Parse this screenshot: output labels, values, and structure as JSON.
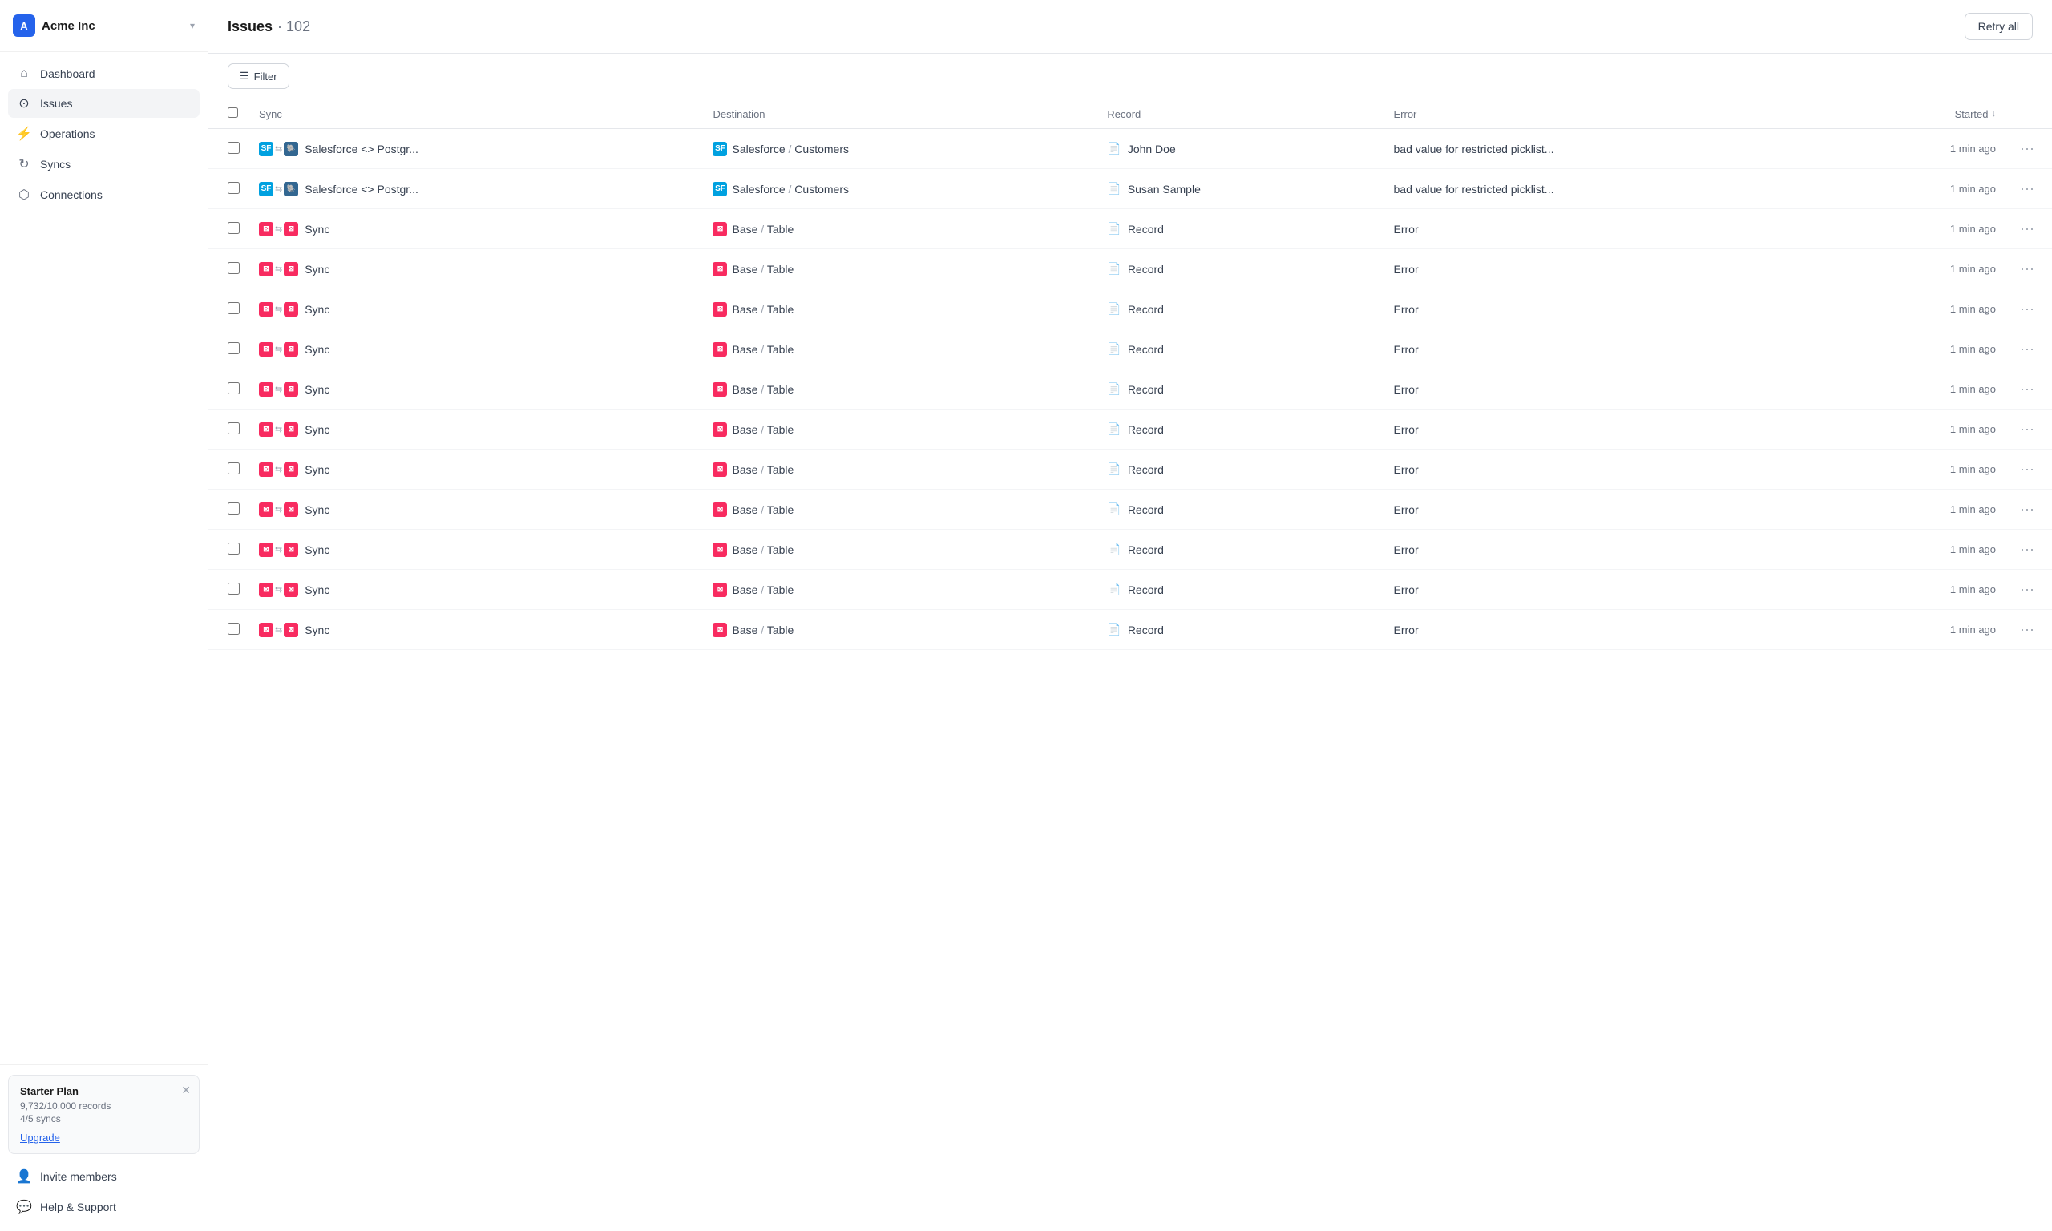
{
  "sidebar": {
    "company": "Acme Inc",
    "avatar_letter": "A",
    "nav_items": [
      {
        "id": "dashboard",
        "label": "Dashboard",
        "icon": "⌂",
        "active": false
      },
      {
        "id": "issues",
        "label": "Issues",
        "icon": "⊙",
        "active": true
      },
      {
        "id": "operations",
        "label": "Operations",
        "icon": "⚡",
        "active": false
      },
      {
        "id": "syncs",
        "label": "Syncs",
        "icon": "↻",
        "active": false
      },
      {
        "id": "connections",
        "label": "Connections",
        "icon": "⬡",
        "active": false
      }
    ],
    "plan": {
      "title": "Starter Plan",
      "records": "9,732/10,000 records",
      "syncs": "4/5 syncs",
      "upgrade_label": "Upgrade"
    },
    "bottom_items": [
      {
        "id": "invite",
        "label": "Invite members",
        "icon": "👤"
      },
      {
        "id": "help",
        "label": "Help & Support",
        "icon": "💬"
      }
    ]
  },
  "header": {
    "title": "Issues",
    "count": "102",
    "retry_button": "Retry all"
  },
  "toolbar": {
    "filter_button": "Filter"
  },
  "table": {
    "columns": [
      "Sync",
      "Destination",
      "Record",
      "Error",
      "Started"
    ],
    "rows": [
      {
        "sync_label": "Salesforce <> Postgr...",
        "sync_type": "sf-pg",
        "destination_icon": "sf",
        "destination": "Salesforce / Customers",
        "record": "John Doe",
        "error": "bad value for restricted picklist...",
        "started": "1 min ago"
      },
      {
        "sync_label": "Salesforce <> Postgr...",
        "sync_type": "sf-pg",
        "destination_icon": "sf",
        "destination": "Salesforce / Customers",
        "record": "Susan Sample",
        "error": "bad value for restricted picklist...",
        "started": "1 min ago"
      },
      {
        "sync_label": "Sync",
        "sync_type": "at-at",
        "destination_icon": "at",
        "destination": "Base / Table",
        "record": "Record",
        "error": "Error",
        "started": "1 min ago"
      },
      {
        "sync_label": "Sync",
        "sync_type": "at-at",
        "destination_icon": "at",
        "destination": "Base / Table",
        "record": "Record",
        "error": "Error",
        "started": "1 min ago"
      },
      {
        "sync_label": "Sync",
        "sync_type": "at-at",
        "destination_icon": "at",
        "destination": "Base / Table",
        "record": "Record",
        "error": "Error",
        "started": "1 min ago"
      },
      {
        "sync_label": "Sync",
        "sync_type": "at-at",
        "destination_icon": "at",
        "destination": "Base / Table",
        "record": "Record",
        "error": "Error",
        "started": "1 min ago"
      },
      {
        "sync_label": "Sync",
        "sync_type": "at-at",
        "destination_icon": "at",
        "destination": "Base / Table",
        "record": "Record",
        "error": "Error",
        "started": "1 min ago"
      },
      {
        "sync_label": "Sync",
        "sync_type": "at-at",
        "destination_icon": "at",
        "destination": "Base / Table",
        "record": "Record",
        "error": "Error",
        "started": "1 min ago"
      },
      {
        "sync_label": "Sync",
        "sync_type": "at-at",
        "destination_icon": "at",
        "destination": "Base / Table",
        "record": "Record",
        "error": "Error",
        "started": "1 min ago"
      },
      {
        "sync_label": "Sync",
        "sync_type": "at-at",
        "destination_icon": "at",
        "destination": "Base / Table",
        "record": "Record",
        "error": "Error",
        "started": "1 min ago"
      },
      {
        "sync_label": "Sync",
        "sync_type": "at-at",
        "destination_icon": "at",
        "destination": "Base / Table",
        "record": "Record",
        "error": "Error",
        "started": "1 min ago"
      },
      {
        "sync_label": "Sync",
        "sync_type": "at-at",
        "destination_icon": "at",
        "destination": "Base / Table",
        "record": "Record",
        "error": "Error",
        "started": "1 min ago"
      },
      {
        "sync_label": "Sync",
        "sync_type": "at-at",
        "destination_icon": "at",
        "destination": "Base / Table",
        "record": "Record",
        "error": "Error",
        "started": "1 min ago"
      }
    ]
  }
}
